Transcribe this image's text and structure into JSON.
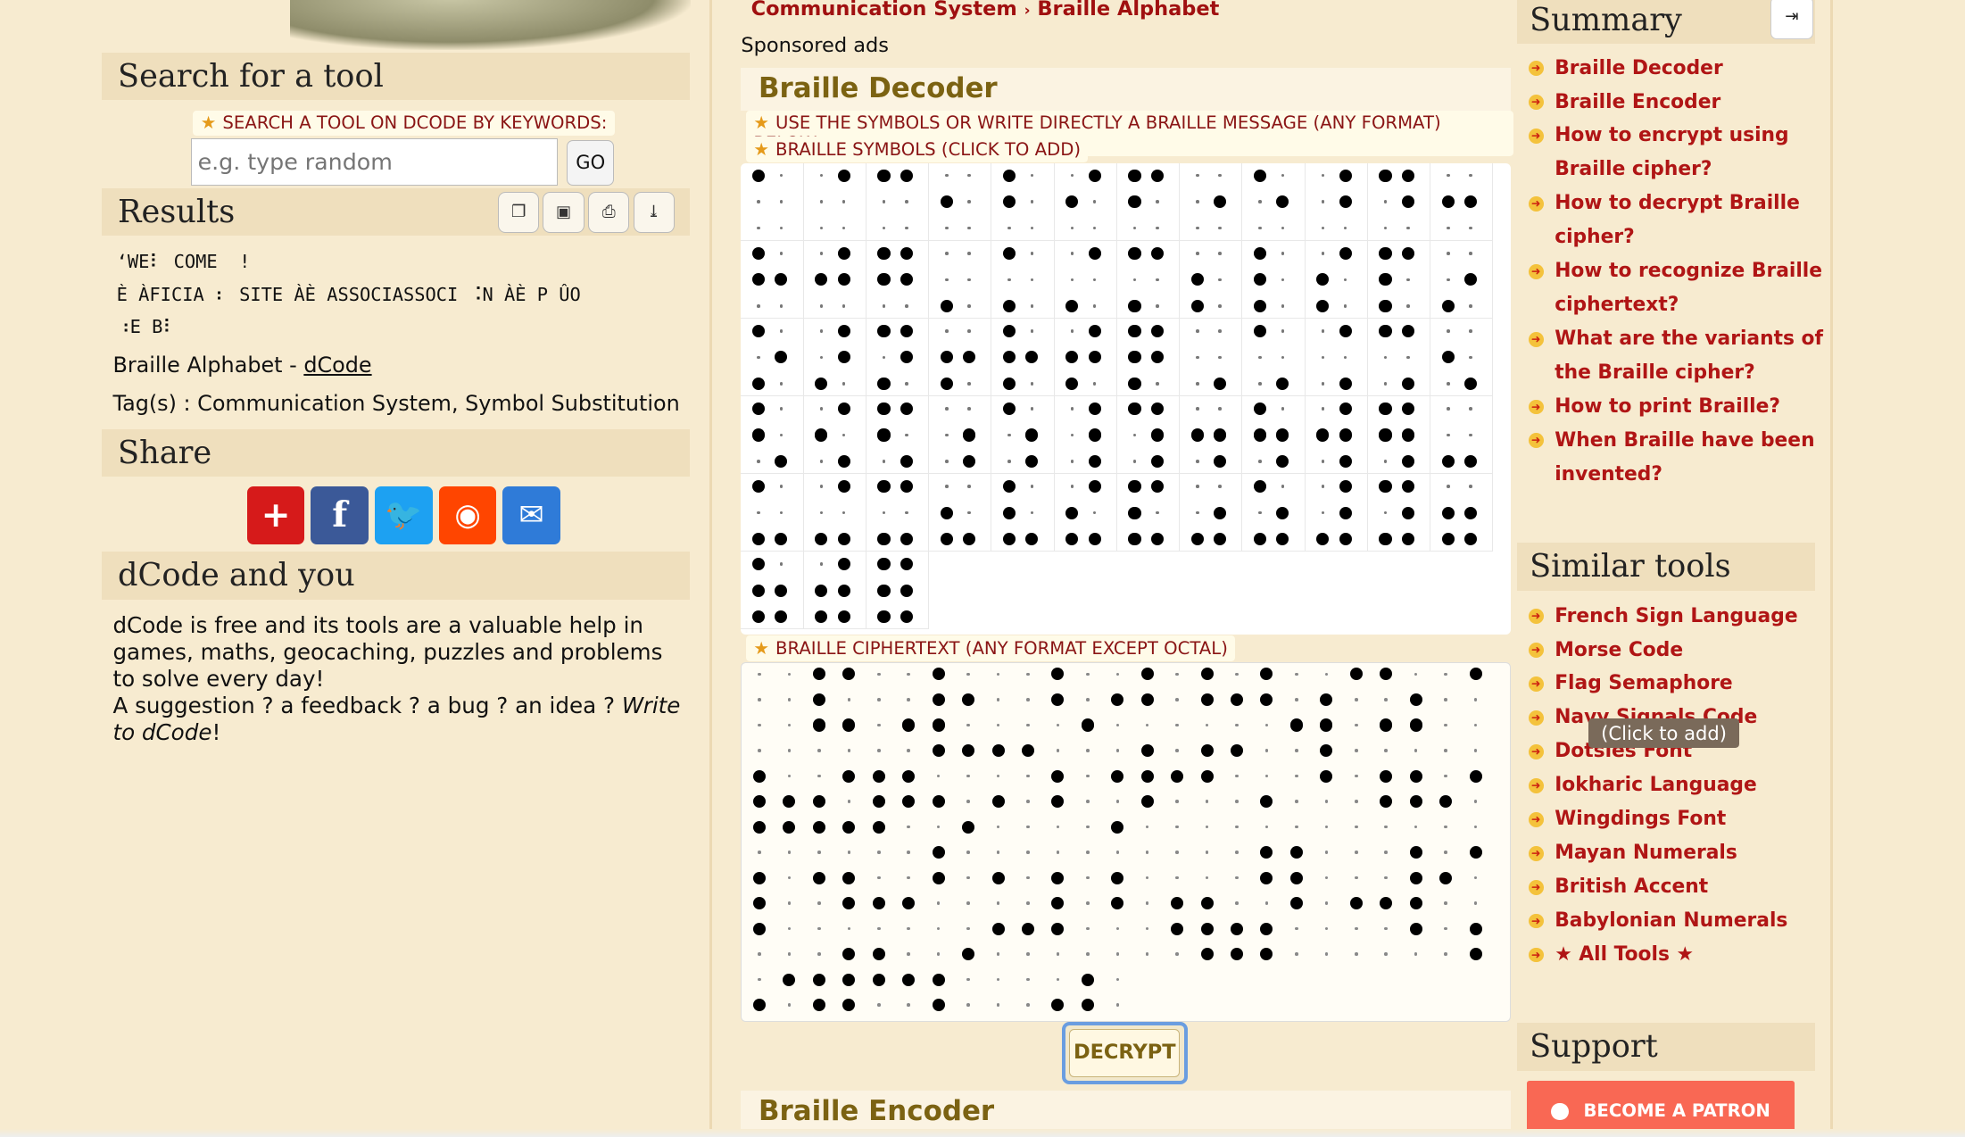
{
  "left": {
    "search_title": "Search for a tool",
    "search_label": "SEARCH A TOOL ON DCODE BY KEYWORDS:",
    "search_placeholder": "e.g. type random",
    "go_label": "GO",
    "results_title": "Results",
    "results_lines": [
      "ʻWE⠇ COME  !",
      "È ÀFICIA ⠆ SITE ÀÈ ASSOCIASSOCI ⠨N ÀÈ P ÛO",
      "⠰E B⠇"
    ],
    "result_tool": "Braille Alphabet - ",
    "result_site": "dCode",
    "tags": "Tag(s) : Communication System, Symbol Substitution",
    "share_title": "Share",
    "dcode_title": "dCode and you",
    "about_text": "dCode is free and its tools are a valuable help in games, maths, geocaching, puzzles and problems to solve every day!",
    "about_q": "A suggestion ? a feedback ? a bug ? an idea ? ",
    "about_write": "Write to dCode",
    "about_end": "!"
  },
  "middle": {
    "crumb1": "Communication System",
    "crumb_sep": "›",
    "crumb2": "Braille Alphabet",
    "sponsored": "Sponsored ads",
    "decoder_title": "Braille Decoder",
    "instruction": "USE THE SYMBOLS OR WRITE DIRECTLY A BRAILLE MESSAGE (ANY FORMAT) BELOW",
    "symbols_label": "BRAILLE SYMBOLS (CLICK TO ADD)",
    "cipher_label": "BRAILLE CIPHERTEXT (ANY FORMAT EXCEPT OCTAL)",
    "decrypt_label": "DECRYPT",
    "encoder_title": "Braille Encoder"
  },
  "right": {
    "summary_title": "Summary",
    "summary_items": [
      "Braille Decoder",
      "Braille Encoder",
      "How to encrypt using Braille cipher?",
      "How to decrypt Braille cipher?",
      "How to recognize Braille ciphertext?",
      "What are the variants of the Braille cipher?",
      "How to print Braille?",
      "When Braille have been invented?"
    ],
    "similar_title": "Similar tools",
    "similar_items": [
      "French Sign Language",
      "Morse Code",
      "Flag Semaphore",
      "Navy Signals Code",
      "Dotsies Font",
      "Iokharic Language",
      "Wingdings Font",
      "Mayan Numerals",
      "British Accent",
      "Babylonian Numerals",
      "★ All Tools ★"
    ],
    "tooltip": "(Click to add)",
    "support_title": "Support",
    "patreon": "BECOME A PATRON"
  },
  "colors": {
    "link": "#b01515",
    "title": "#7b6212",
    "bar": "#efdfbd",
    "bg": "#f7ebd0"
  }
}
